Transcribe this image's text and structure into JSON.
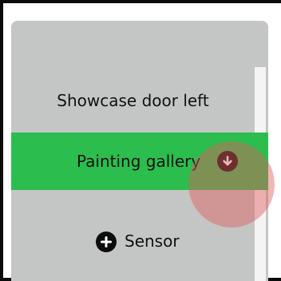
{
  "menu": {
    "items": [
      {
        "label": "Showcase door left"
      },
      {
        "label": "Painting gallery",
        "icon": "arrow-down-circle-icon"
      },
      {
        "label": "Sensor",
        "icon": "plus-circle-icon"
      }
    ],
    "selected_index": 1,
    "colors": {
      "panel": "#c4c6c5",
      "selected": "#2bbd4d",
      "cursor_highlight": "#e15a5a"
    }
  }
}
